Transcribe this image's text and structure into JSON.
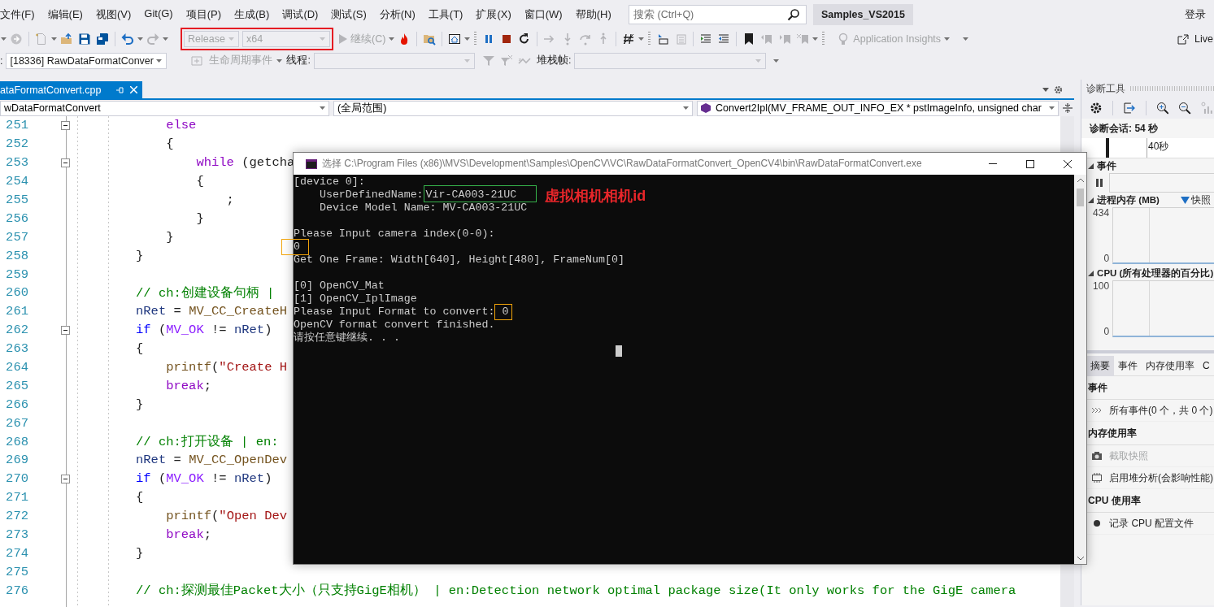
{
  "menu_bar": {
    "items": [
      "文件(F)",
      "编辑(E)",
      "视图(V)",
      "Git(G)",
      "项目(P)",
      "生成(B)",
      "调试(D)",
      "测试(S)",
      "分析(N)",
      "工具(T)",
      "扩展(X)",
      "窗口(W)",
      "帮助(H)"
    ],
    "search": {
      "placeholder": "搜索 (Ctrl+Q)"
    },
    "solution_name": "Samples_VS2015",
    "sign_in": "登录"
  },
  "toolbar": {
    "highlighted": true,
    "configuration": {
      "value": "Release",
      "disabled": true
    },
    "platform": {
      "value": "x64",
      "disabled": true
    },
    "continue": {
      "label": "继续(C)",
      "disabled": true
    },
    "insights": {
      "label": "Application Insights",
      "disabled": true
    },
    "live_share": "Live"
  },
  "debug_location_bar": {
    "process_label": ":",
    "process": "[18336] RawDataFormatConver",
    "lifecycle_events": {
      "label": "生命周期事件",
      "disabled": true
    },
    "thread_label": "线程:",
    "stack_frame_label": "堆栈帧:"
  },
  "document_tab": {
    "title": "ataFormatConvert.cpp",
    "selected": true
  },
  "navigation_bar": {
    "project": "wDataFormatConvert",
    "scope": "(全局范围)",
    "member": "Convert2Ipl(MV_FRAME_OUT_INFO_EX * pstImageInfo, unsigned char"
  },
  "editor": {
    "lines": [
      {
        "number": "251",
        "foldable": true,
        "segments": [
          {
            "kind": "keyword",
            "text": "    else"
          }
        ]
      },
      {
        "number": "252",
        "foldable": false,
        "segments": [
          {
            "kind": "plain",
            "text": "    {"
          }
        ]
      },
      {
        "number": "253",
        "foldable": true,
        "segments": [
          {
            "kind": "keyword",
            "text": "        while"
          },
          {
            "kind": "plain",
            "text": " (getcha"
          }
        ]
      },
      {
        "number": "254",
        "foldable": false,
        "segments": [
          {
            "kind": "plain",
            "text": "        {"
          }
        ]
      },
      {
        "number": "255",
        "foldable": false,
        "segments": [
          {
            "kind": "plain",
            "text": "            ;"
          }
        ]
      },
      {
        "number": "256",
        "foldable": false,
        "segments": [
          {
            "kind": "plain",
            "text": "        }"
          }
        ]
      },
      {
        "number": "257",
        "foldable": false,
        "segments": [
          {
            "kind": "plain",
            "text": "    }"
          }
        ]
      },
      {
        "number": "258",
        "foldable": false,
        "segments": [
          {
            "kind": "plain",
            "text": "}"
          }
        ]
      },
      {
        "number": "259",
        "foldable": false
      },
      {
        "number": "260",
        "foldable": false,
        "segments": [
          {
            "kind": "comment",
            "text": "// ch:创建设备句柄 |"
          }
        ]
      },
      {
        "number": "261",
        "foldable": false,
        "segments": [
          {
            "kind": "variable",
            "text": "nRet"
          },
          {
            "kind": "plain",
            "text": " = "
          },
          {
            "kind": "function",
            "text": "MV_CC_CreateH"
          }
        ]
      },
      {
        "number": "262",
        "foldable": true,
        "segments": [
          {
            "kind": "control",
            "text": "if"
          },
          {
            "kind": "plain",
            "text": " ("
          },
          {
            "kind": "macro",
            "text": "MV_OK"
          },
          {
            "kind": "plain",
            "text": " != "
          },
          {
            "kind": "variable",
            "text": "nRet"
          },
          {
            "kind": "plain",
            "text": ")"
          }
        ]
      },
      {
        "number": "263",
        "foldable": false,
        "segments": [
          {
            "kind": "plain",
            "text": "{"
          }
        ]
      },
      {
        "number": "264",
        "foldable": false,
        "segments": [
          {
            "kind": "function",
            "text": "    printf"
          },
          {
            "kind": "plain",
            "text": "("
          },
          {
            "kind": "string",
            "text": "\"Create H"
          }
        ]
      },
      {
        "number": "265",
        "foldable": false,
        "segments": [
          {
            "kind": "keyword",
            "text": "    break"
          },
          {
            "kind": "plain",
            "text": ";"
          }
        ]
      },
      {
        "number": "266",
        "foldable": false,
        "segments": [
          {
            "kind": "plain",
            "text": "}"
          }
        ]
      },
      {
        "number": "267",
        "foldable": false
      },
      {
        "number": "268",
        "foldable": false,
        "segments": [
          {
            "kind": "comment",
            "text": "// ch:打开设备 | en:"
          }
        ]
      },
      {
        "number": "269",
        "foldable": false,
        "segments": [
          {
            "kind": "variable",
            "text": "nRet"
          },
          {
            "kind": "plain",
            "text": " = "
          },
          {
            "kind": "function",
            "text": "MV_CC_OpenDev"
          }
        ]
      },
      {
        "number": "270",
        "foldable": true,
        "segments": [
          {
            "kind": "control",
            "text": "if"
          },
          {
            "kind": "plain",
            "text": " ("
          },
          {
            "kind": "macro",
            "text": "MV_OK"
          },
          {
            "kind": "plain",
            "text": " != "
          },
          {
            "kind": "variable",
            "text": "nRet"
          },
          {
            "kind": "plain",
            "text": ")"
          }
        ]
      },
      {
        "number": "271",
        "foldable": false,
        "segments": [
          {
            "kind": "plain",
            "text": "{"
          }
        ]
      },
      {
        "number": "272",
        "foldable": false,
        "segments": [
          {
            "kind": "function",
            "text": "    printf"
          },
          {
            "kind": "plain",
            "text": "("
          },
          {
            "kind": "string",
            "text": "\"Open Dev"
          }
        ]
      },
      {
        "number": "273",
        "foldable": false,
        "segments": [
          {
            "kind": "keyword",
            "text": "    break"
          },
          {
            "kind": "plain",
            "text": ";"
          }
        ]
      },
      {
        "number": "274",
        "foldable": false,
        "segments": [
          {
            "kind": "plain",
            "text": "}"
          }
        ]
      },
      {
        "number": "275",
        "foldable": false
      },
      {
        "number": "276",
        "foldable": false,
        "segments": [
          {
            "kind": "comment",
            "text": "// ch:探测最佳Packet大小（只支持GigE相机） | en:Detection network optimal package size(It only works for the GigE camera"
          }
        ]
      }
    ]
  },
  "console_window": {
    "title": "选择 C:\\Program Files (x86)\\MVS\\Development\\Samples\\OpenCV\\VC\\RawDataFormatConvert_OpenCV4\\bin\\RawDataFormatConvert.exe",
    "lines": [
      {
        "space_before": false,
        "segments": [
          {
            "text": "[device 0]:"
          }
        ]
      },
      {
        "space_before": false,
        "segments": [
          {
            "text": "    UserDefinedName:"
          },
          {
            "text": "Vir-CA003-21UC",
            "color": "#35b34a"
          }
        ],
        "note": "虚拟相机相机id"
      },
      {
        "space_before": false,
        "segments": [
          {
            "text": "    Device Model Name: MV-CA003-21UC"
          }
        ]
      },
      {
        "space_before": true,
        "segments": [
          {
            "text": "Please Input camera index(0-0):"
          }
        ]
      },
      {
        "space_before": false,
        "segments": [
          {
            "text": "0",
            "color": "#f0a30a"
          }
        ]
      },
      {
        "space_before": false,
        "segments": [
          {
            "text": "Get One Frame: Width[640], Height[480], FrameNum[0]"
          }
        ]
      },
      {
        "space_before": true,
        "segments": [
          {
            "text": "[0] OpenCV_Mat"
          }
        ]
      },
      {
        "space_before": false,
        "segments": [
          {
            "text": "[1] OpenCV_IplImage"
          }
        ]
      },
      {
        "space_before": false,
        "segments": [
          {
            "text": "Please Input Format to convert:"
          },
          {
            "text": "0",
            "color": "#f0a30a"
          }
        ]
      },
      {
        "space_before": false,
        "segments": [
          {
            "text": "OpenCV format convert finished."
          }
        ]
      },
      {
        "space_before": false,
        "segments": [
          {
            "text": "请按任意键继续. . ."
          }
        ]
      }
    ]
  },
  "diagnostic_tools": {
    "title": "诊断工具",
    "session": "诊断会话: 54 秒",
    "timeline_label": "40秒",
    "events_section": {
      "label": "事件",
      "expanded": true
    },
    "memory_section": {
      "label": "进程内存 (MB)",
      "expanded": true,
      "snapshot": "快照",
      "y_max": "434",
      "y_min": "0"
    },
    "cpu_section": {
      "label": "CPU (所有处理器的百分比)",
      "expanded": true,
      "y_max": "100",
      "y_min": "0"
    },
    "tabs": [
      {
        "label": "摘要",
        "selected": true
      },
      {
        "label": "事件",
        "selected": false
      },
      {
        "label": "内存使用率",
        "selected": false
      },
      {
        "label": "C",
        "selected": false
      }
    ],
    "summary": [
      {
        "heading": "事件",
        "items": [
          {
            "kind": "events",
            "label": "所有事件(0 个，共 0 个)",
            "disabled": false
          }
        ]
      },
      {
        "heading": "内存使用率",
        "items": [
          {
            "kind": "snapshot",
            "label": "截取快照",
            "disabled": true
          },
          {
            "kind": "heap",
            "label": "启用堆分析(会影响性能)",
            "disabled": false
          }
        ]
      },
      {
        "heading": "CPU 使用率",
        "items": [
          {
            "kind": "record",
            "label": "记录 CPU 配置文件",
            "disabled": false
          }
        ]
      }
    ]
  }
}
